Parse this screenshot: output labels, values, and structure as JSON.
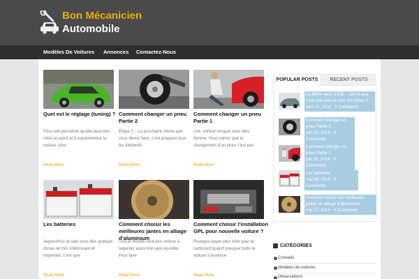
{
  "site": {
    "logo_line1": "Bon Mécanicien",
    "logo_line2": "Automobile",
    "logo_icon": "car-wrench-icon",
    "accent_color": "#f2a900"
  },
  "nav": {
    "items": [
      {
        "label": "Modèles De Voitures"
      },
      {
        "label": "Annonces"
      },
      {
        "label": "Contactez-Nous"
      }
    ]
  },
  "posts": [
    {
      "title": "Quel est le réglage (tuning) ?",
      "excerpt": "Pour une personne qu’elle peut être mise au point et à expérimenter la voiture, pour",
      "read_more": "Read More",
      "image": "green-car-photo"
    },
    {
      "title": "Comment changer un pneu Partie 2",
      "excerpt": "Étape 2 – La prochaine chose que vous devez faire, c’est préparer tous les éléments",
      "read_more": "Read More",
      "image": "tire-change-photo"
    },
    {
      "title": "Comment changer un pneu Partie 1",
      "excerpt": "Lire, surtout lorsque vous êtes femme. Vous verrez que le changement d’un pneu c’est pas",
      "read_more": "Read More",
      "image": "woman-tire-photo"
    },
    {
      "title": "Les batteries",
      "excerpt": "Aujourd’hui, je vais vous dire quelque chose de très intéressant et important, c’est que",
      "read_more": "Read More",
      "image": "car-batteries-photo"
    },
    {
      "title": "Comment choisir les meilleures jantes en alliage d’aluminium",
      "excerpt": "Tout le monde veut leur voiture à regarder aussi bon que possible. Pour faire",
      "read_more": "Read More",
      "image": "alloy-wheel-photo"
    },
    {
      "title": "Comment choisir l’installation GPL pour nouvelle voiture ?",
      "excerpt": "Pourquoi payer plus cher pour le carburant quand presque toute la voiture à essence",
      "read_more": "Read More",
      "image": "engine-bay-photo"
    }
  ],
  "sidebar": {
    "tabs": [
      {
        "label": "POPULAR POSTS",
        "active": true
      },
      {
        "label": "RECENT POSTS",
        "active": false
      }
    ],
    "popular": [
      {
        "title": "La BMW série 3 E90 – est-ce que c’est une voiture pour les riches ?",
        "meta": "avril 10, 2014 · 0 Comments"
      },
      {
        "title": "Comment changer un pneu Partie 2",
        "meta": "juin 12, 2014 · 0 Comments"
      },
      {
        "title": "Comment changer un pneu Partie 1",
        "meta": "juin 26, 2014 · 0 Comments"
      },
      {
        "title": "Les batteries",
        "meta": "mai 29, 2014 · 0 Comments"
      },
      {
        "title": "Comment choisir les meilleures jantes en alliage d’aluminium",
        "meta": "mai 27, 2014 · 0 Comments"
      }
    ],
    "categories_heading": "CATÉGORIES",
    "categories": [
      {
        "label": "Conseils"
      },
      {
        "label": "Modèles de voitures"
      },
      {
        "label": "Observations"
      }
    ]
  }
}
